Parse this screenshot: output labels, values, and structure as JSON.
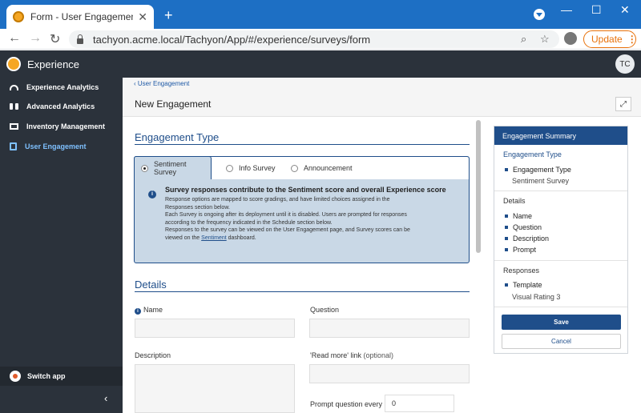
{
  "browser": {
    "tab_title": "Form - User Engagement - Experience",
    "url": "tachyon.acme.local/Tachyon/App/#/experience/surveys/form",
    "update_label": "Update"
  },
  "app": {
    "title": "Experience",
    "user_initials": "TC"
  },
  "sidebar": {
    "items": [
      {
        "label": "Experience Analytics"
      },
      {
        "label": "Advanced Analytics"
      },
      {
        "label": "Inventory Management"
      },
      {
        "label": "User Engagement"
      }
    ],
    "switch_app": "Switch app"
  },
  "main": {
    "breadcrumb": "User Engagement",
    "page_title": "New Engagement",
    "engagement_type": {
      "title": "Engagement Type",
      "options": [
        "Sentiment Survey",
        "Info Survey",
        "Announcement"
      ],
      "selected": "Sentiment Survey",
      "info_heading": "Survey responses contribute to the Sentiment score and overall Experience score",
      "info_lines": [
        "Response options are mapped to score gradings, and have limited choices assigned in the",
        "Responses section below.",
        "Each Survey is ongoing after its deployment until it is disabled. Users are prompted for responses",
        "according to the frequency indicated in the Schedule section below.",
        "Responses to the survey can be viewed on the User Engagement page, and Survey scores can be"
      ],
      "info_last_pre": "viewed on the ",
      "info_link": "Sentiment",
      "info_last_post": " dashboard."
    },
    "details": {
      "title": "Details",
      "name_label": "Name",
      "question_label": "Question",
      "description_label": "Description",
      "read_more_label": "'Read more' link",
      "optional_label": "(optional)",
      "prompt_label": "Prompt question every",
      "prompt_value": "0"
    }
  },
  "summary": {
    "title": "Engagement Summary",
    "sections": {
      "type_title": "Engagement Type",
      "type_item": "Engagement Type",
      "type_value": "Sentiment Survey",
      "details_title": "Details",
      "details_items": [
        "Name",
        "Question",
        "Description",
        "Prompt"
      ],
      "responses_title": "Responses",
      "responses_item": "Template",
      "responses_value": "Visual Rating 3"
    },
    "save_label": "Save",
    "cancel_label": "Cancel"
  },
  "colors": {
    "chrome_blue": "#1d6fc4",
    "nav_dark": "#2b323b",
    "accent_blue": "#1f4e8a",
    "info_bg": "#c9d8e6",
    "update_orange": "#e8710a"
  }
}
